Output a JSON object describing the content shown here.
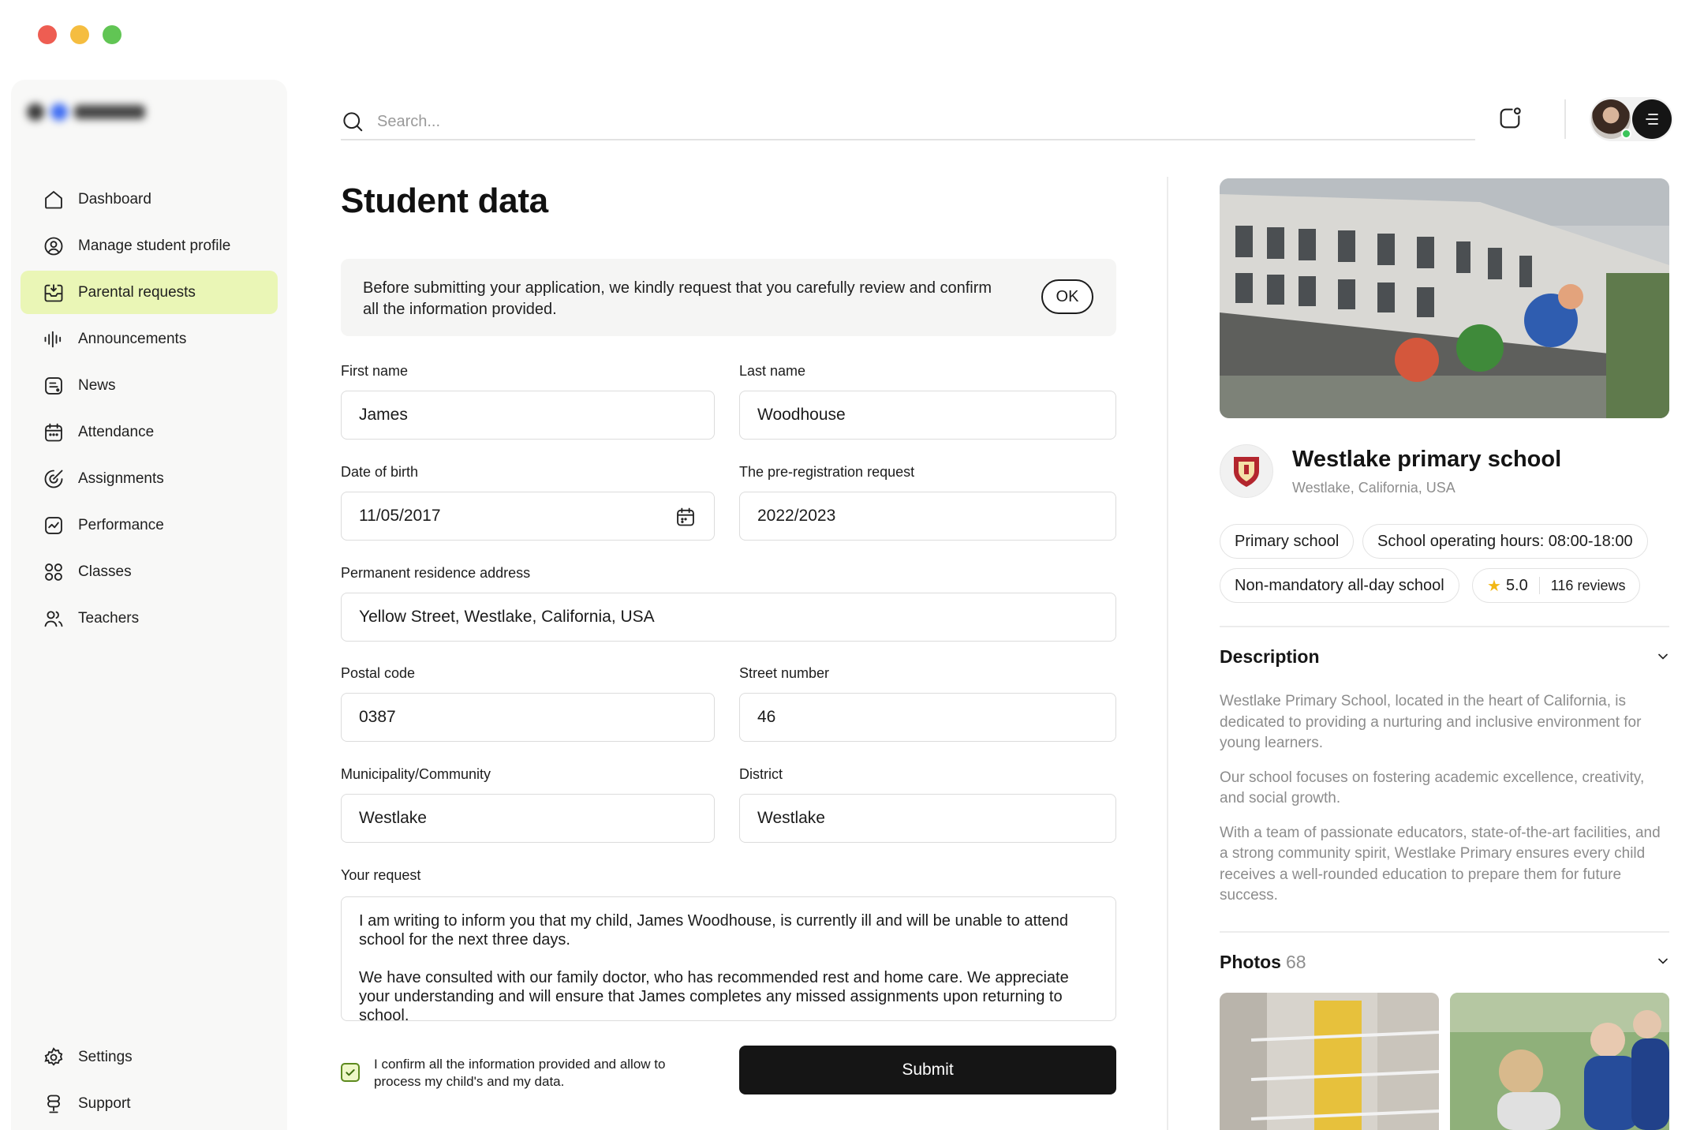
{
  "window": {
    "controls": [
      "close",
      "minimize",
      "maximize"
    ]
  },
  "sidebar": {
    "items": [
      {
        "label": "Dashboard",
        "icon": "home-icon",
        "active": false
      },
      {
        "label": "Manage student profile",
        "icon": "user-circle-icon",
        "active": false
      },
      {
        "label": "Parental requests",
        "icon": "inbox-icon",
        "active": true
      },
      {
        "label": "Announcements",
        "icon": "sound-wave-icon",
        "active": false
      },
      {
        "label": "News",
        "icon": "news-icon",
        "active": false
      },
      {
        "label": "Attendance",
        "icon": "calendar-icon",
        "active": false
      },
      {
        "label": "Assignments",
        "icon": "assignment-icon",
        "active": false
      },
      {
        "label": "Performance",
        "icon": "chart-icon",
        "active": false
      },
      {
        "label": "Classes",
        "icon": "grid-circles-icon",
        "active": false
      },
      {
        "label": "Teachers",
        "icon": "users-icon",
        "active": false
      }
    ],
    "bottom_items": [
      {
        "label": "Settings",
        "icon": "gear-icon"
      },
      {
        "label": "Support",
        "icon": "support-icon"
      }
    ]
  },
  "search": {
    "placeholder": "Search..."
  },
  "main": {
    "title": "Student data",
    "notice": {
      "text": "Before submitting your application, we kindly request that you carefully review and confirm all the information provided.",
      "button": "OK"
    },
    "fields": {
      "first_name": {
        "label": "First name",
        "value": "James"
      },
      "last_name": {
        "label": "Last name",
        "value": "Woodhouse"
      },
      "dob": {
        "label": "Date of birth",
        "value": "11/05/2017"
      },
      "prereg": {
        "label": "The pre-registration request",
        "value": "2022/2023"
      },
      "address": {
        "label": "Permanent residence address",
        "value": "Yellow Street, Westlake, California, USA"
      },
      "postal": {
        "label": "Postal code",
        "value": "0387"
      },
      "street_no": {
        "label": "Street number",
        "value": "46"
      },
      "municipality": {
        "label": "Municipality/Community",
        "value": "Westlake"
      },
      "district": {
        "label": "District",
        "value": "Westlake"
      }
    },
    "request": {
      "label": "Your request",
      "paragraph1": "I am writing to inform you that my child, James Woodhouse, is currently ill and will be unable to attend school for the next three days.",
      "paragraph2": "We have consulted with our family doctor, who has recommended rest and home care. We appreciate your understanding and will ensure that James completes any missed assignments upon returning to school."
    },
    "confirm": {
      "checked": true,
      "label": "I confirm all the information provided and allow to process my child's and my data."
    },
    "submit": "Submit"
  },
  "school": {
    "name": "Westlake primary school",
    "location": "Westlake, California, USA",
    "tags": [
      "Primary school",
      "School operating hours: 08:00-18:00",
      "Non-mandatory all-day school"
    ],
    "rating": "5.0",
    "reviews": "116 reviews",
    "description": {
      "title": "Description",
      "paragraphs": [
        "Westlake Primary School, located in the heart of California, is dedicated to providing a nurturing and inclusive environment for young learners.",
        "Our school focuses on fostering academic excellence, creativity, and social growth.",
        "With a team of passionate educators, state-of-the-art facilities, and a strong community spirit, Westlake Primary ensures every child receives a well-rounded education to prepare them for future success."
      ]
    },
    "photos": {
      "title": "Photos",
      "count": "68"
    }
  },
  "colors": {
    "accent_active": "#eaf6b6",
    "primary_button": "#151515",
    "online": "#3bc45a",
    "star": "#f2b714"
  }
}
